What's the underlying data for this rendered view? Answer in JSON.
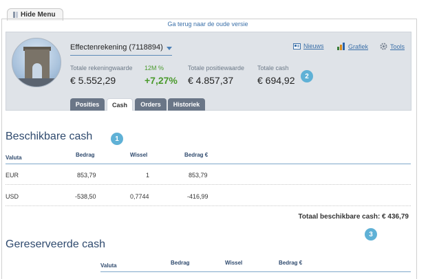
{
  "sidebar_toggle": {
    "label": "Hide Menu",
    "icon": "collapse-icon"
  },
  "old_version_link": "Ga terug naar de oude versie",
  "account": {
    "selected": "Effectenrekening (7118894)",
    "avatar_icon": "arc-de-triomphe-photo"
  },
  "stats": {
    "total_account_label": "Totale rekeningwaarde",
    "total_account_value": "€ 5.552,29",
    "return_label": "12M %",
    "return_value": "+7,27%",
    "positions_label": "Totale positiewaarde",
    "positions_value": "€ 4.857,37",
    "cash_label": "Totale cash",
    "cash_value": "€ 694,92"
  },
  "links": {
    "news": {
      "label": "Nieuws",
      "icon": "news-icon"
    },
    "chart": {
      "label": "Grafiek",
      "icon": "bar-chart-icon"
    },
    "tools": {
      "label": "Tools",
      "icon": "gear-icon"
    }
  },
  "tabs": [
    {
      "label": "Posities",
      "active": false
    },
    {
      "label": "Cash",
      "active": true
    },
    {
      "label": "Orders",
      "active": false
    },
    {
      "label": "Historiek",
      "active": false
    }
  ],
  "available_cash": {
    "title": "Beschikbare cash",
    "columns": [
      "Valuta",
      "Bedrag",
      "Wissel",
      "Bedrag €"
    ],
    "rows": [
      [
        "EUR",
        "853,79",
        "1",
        "853,79"
      ],
      [
        "USD",
        "-538,50",
        "0,7744",
        "-416,99"
      ]
    ],
    "total": "Totaal beschikbare cash: € 436,79"
  },
  "reserved_cash": {
    "title": "Gereserveerde cash",
    "columns": [
      "Valuta",
      "Bedrag",
      "Wissel",
      "Bedrag €"
    ]
  },
  "badges": [
    "1",
    "2",
    "3"
  ],
  "colors": {
    "accent": "#5fb1d6",
    "positive": "#4a9a2c",
    "link": "#3a6fa8",
    "tab": "#6a7687"
  }
}
